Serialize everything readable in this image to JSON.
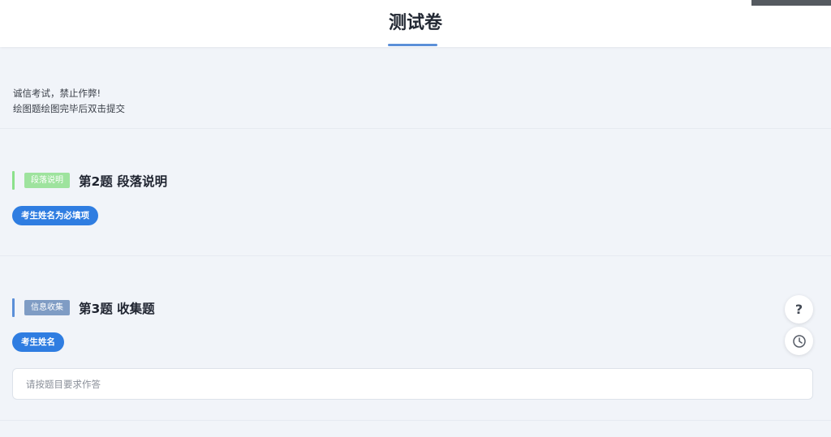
{
  "header": {
    "title": "测试卷"
  },
  "notice": {
    "line1": "诚信考试，禁止作弊!",
    "line2": "绘图题绘图完毕后双击提交"
  },
  "questions": [
    {
      "tag": "段落说明",
      "title": "第2题 段落说明",
      "pill": "考生姓名为必填项",
      "accent": "#8be08b",
      "tag_color": "#9ee39e"
    },
    {
      "tag": "信息收集",
      "title": "第3题 收集题",
      "pill": "考生姓名",
      "accent": "#5b8fd8",
      "tag_color": "#7f9cc4",
      "input_placeholder": "请按题目要求作答"
    }
  ],
  "float_buttons": {
    "help_icon": "help-icon",
    "help_label": "?",
    "history_icon": "clock-icon"
  },
  "colors": {
    "primary": "#2f7de1",
    "background": "#f1f4f9"
  }
}
